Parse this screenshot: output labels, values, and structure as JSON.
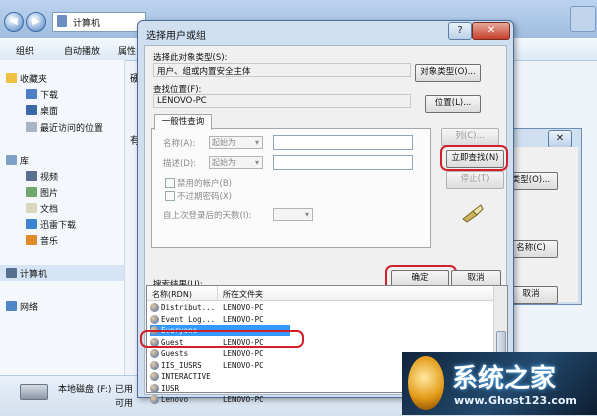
{
  "explorer": {
    "address": "计算机",
    "toolbar": [
      "组织",
      "自动播放",
      "属性"
    ],
    "sidebar": {
      "favorites": "收藏夹",
      "items": [
        "下载",
        "桌面",
        "最近访问的位置"
      ],
      "library": "库",
      "library_items": [
        "视频",
        "图片",
        "文档",
        "迅雷下载",
        "音乐"
      ],
      "computer": "计算机",
      "network": "网络"
    },
    "partial_labels": [
      "硬",
      "有"
    ],
    "status": {
      "drive_name": "本地磁盘 (F:)",
      "drive_used": "已用",
      "drive_free": "可用"
    }
  },
  "dialog": {
    "title": "选择用户或组",
    "object_type_label": "选择此对象类型(S):",
    "object_type_value": "用户、组或内置安全主体",
    "object_type_button": "对象类型(O)...",
    "location_label": "查找位置(F):",
    "location_value": "LENOVO-PC",
    "location_button": "位置(L)...",
    "tab": "一般性查询",
    "name_label": "名称(A):",
    "name_combo": "起始为",
    "desc_label": "描述(D):",
    "desc_combo": "起始为",
    "disabled_accounts": "禁用的帐户(B)",
    "no_expire": "不过期密码(X)",
    "days_label": "自上次登录后的天数(I):",
    "columns_button": "列(C)...",
    "find_now_button": "立即查找(N)",
    "stop_button": "停止(T)",
    "ok_button": "确定",
    "cancel_button": "取消",
    "results_label": "搜索结果(U):",
    "col_name": "名称(RDN)",
    "col_folder": "所在文件夹",
    "rows": [
      {
        "name": "Distribut...",
        "folder": "LENOVO-PC"
      },
      {
        "name": "Event Log...",
        "folder": "LENOVO-PC"
      },
      {
        "name": "Everyone",
        "folder": ""
      },
      {
        "name": "Guest",
        "folder": "LENOVO-PC"
      },
      {
        "name": "Guests",
        "folder": "LENOVO-PC"
      },
      {
        "name": "IIS_IUSRS",
        "folder": "LENOVO-PC"
      },
      {
        "name": "INTERACTIVE",
        "folder": ""
      },
      {
        "name": "IUSR",
        "folder": ""
      },
      {
        "name": "Lenovo",
        "folder": "LENOVO-PC"
      }
    ],
    "selected_row": 2
  },
  "second_window": {
    "obj_btn": "类型(O)...",
    "check_btn": "名称(C)",
    "cancel_btn": "取消"
  },
  "watermark": {
    "title": "系统之家",
    "url": "www.Ghost123.com"
  },
  "colors": {
    "highlight_red": "#d0202a",
    "selection_blue": "#3399ff",
    "titlebar": "#cfdff0"
  }
}
